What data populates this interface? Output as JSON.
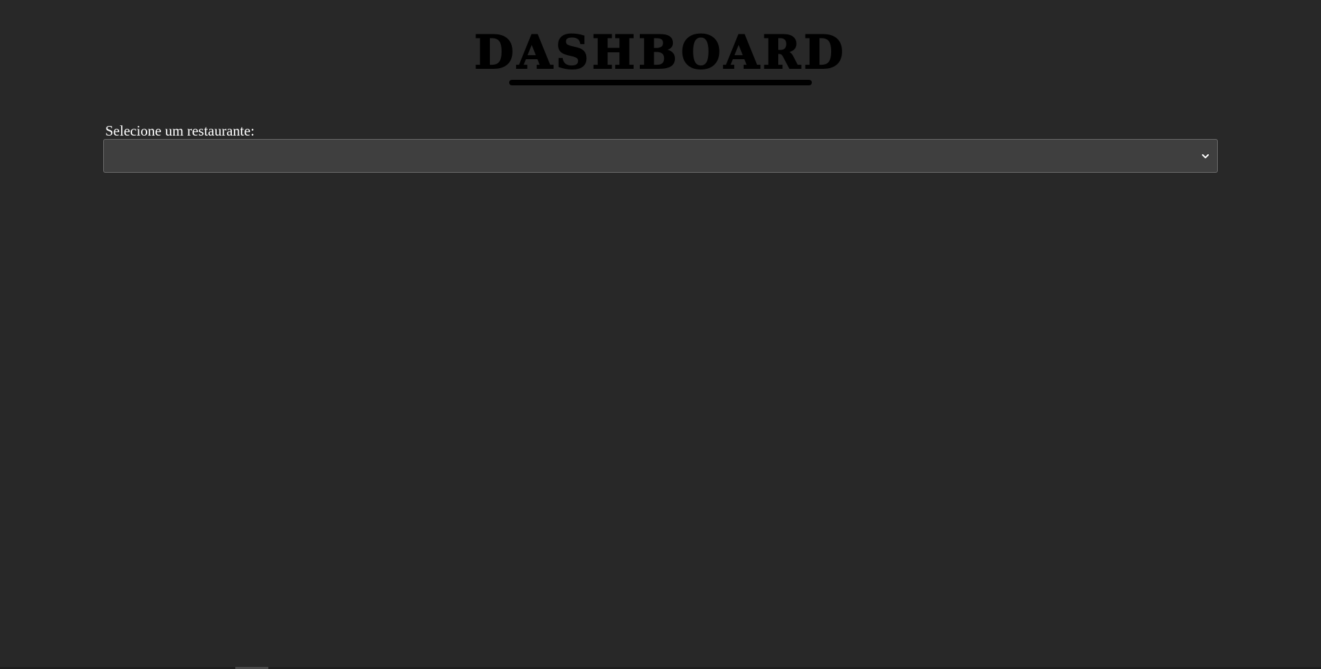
{
  "header": {
    "title": "DASHBOARD"
  },
  "form": {
    "label": "Selecione um restaurante:",
    "select": {
      "value": "",
      "options": []
    }
  },
  "colors": {
    "background": "#282828",
    "title": "#000000",
    "select_background": "#3f3f3f",
    "select_border": "#6c6c6c",
    "text": "#ffffff"
  },
  "icons": {
    "select_chevron": "chevron-down-icon"
  }
}
